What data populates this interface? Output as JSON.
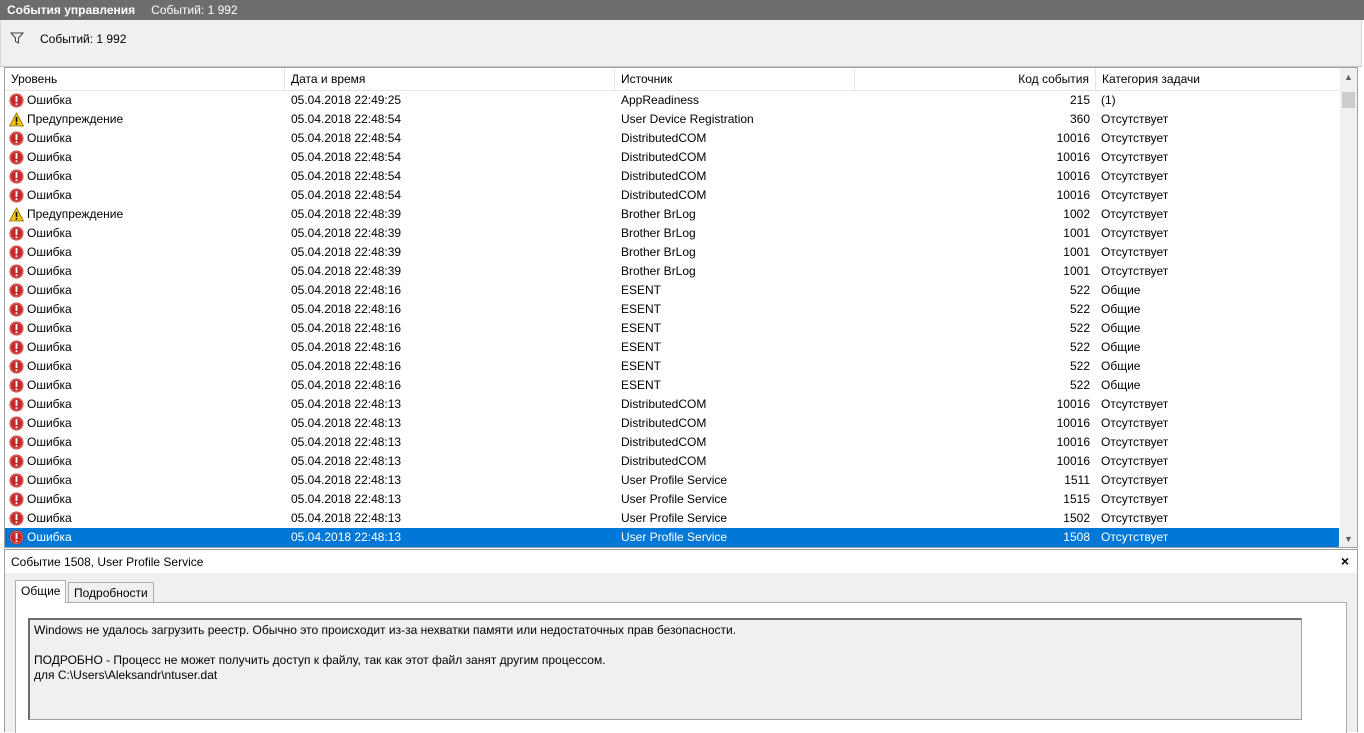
{
  "titlebar": {
    "title": "События управления",
    "count": "Событий: 1 992"
  },
  "filterbar": {
    "text": "Событий: 1 992",
    "icon": "filter-icon"
  },
  "columns": [
    "Уровень",
    "Дата и время",
    "Источник",
    "Код события",
    "Категория задачи"
  ],
  "rows": [
    {
      "level": "Ошибка",
      "type": "error",
      "date": "05.04.2018 22:49:25",
      "source": "AppReadiness",
      "code": "215",
      "category": "(1)"
    },
    {
      "level": "Предупреждение",
      "type": "warning",
      "date": "05.04.2018 22:48:54",
      "source": "User Device Registration",
      "code": "360",
      "category": "Отсутствует"
    },
    {
      "level": "Ошибка",
      "type": "error",
      "date": "05.04.2018 22:48:54",
      "source": "DistributedCOM",
      "code": "10016",
      "category": "Отсутствует"
    },
    {
      "level": "Ошибка",
      "type": "error",
      "date": "05.04.2018 22:48:54",
      "source": "DistributedCOM",
      "code": "10016",
      "category": "Отсутствует"
    },
    {
      "level": "Ошибка",
      "type": "error",
      "date": "05.04.2018 22:48:54",
      "source": "DistributedCOM",
      "code": "10016",
      "category": "Отсутствует"
    },
    {
      "level": "Ошибка",
      "type": "error",
      "date": "05.04.2018 22:48:54",
      "source": "DistributedCOM",
      "code": "10016",
      "category": "Отсутствует"
    },
    {
      "level": "Предупреждение",
      "type": "warning",
      "date": "05.04.2018 22:48:39",
      "source": "Brother BrLog",
      "code": "1002",
      "category": "Отсутствует"
    },
    {
      "level": "Ошибка",
      "type": "error",
      "date": "05.04.2018 22:48:39",
      "source": "Brother BrLog",
      "code": "1001",
      "category": "Отсутствует"
    },
    {
      "level": "Ошибка",
      "type": "error",
      "date": "05.04.2018 22:48:39",
      "source": "Brother BrLog",
      "code": "1001",
      "category": "Отсутствует"
    },
    {
      "level": "Ошибка",
      "type": "error",
      "date": "05.04.2018 22:48:39",
      "source": "Brother BrLog",
      "code": "1001",
      "category": "Отсутствует"
    },
    {
      "level": "Ошибка",
      "type": "error",
      "date": "05.04.2018 22:48:16",
      "source": "ESENT",
      "code": "522",
      "category": "Общие"
    },
    {
      "level": "Ошибка",
      "type": "error",
      "date": "05.04.2018 22:48:16",
      "source": "ESENT",
      "code": "522",
      "category": "Общие"
    },
    {
      "level": "Ошибка",
      "type": "error",
      "date": "05.04.2018 22:48:16",
      "source": "ESENT",
      "code": "522",
      "category": "Общие"
    },
    {
      "level": "Ошибка",
      "type": "error",
      "date": "05.04.2018 22:48:16",
      "source": "ESENT",
      "code": "522",
      "category": "Общие"
    },
    {
      "level": "Ошибка",
      "type": "error",
      "date": "05.04.2018 22:48:16",
      "source": "ESENT",
      "code": "522",
      "category": "Общие"
    },
    {
      "level": "Ошибка",
      "type": "error",
      "date": "05.04.2018 22:48:16",
      "source": "ESENT",
      "code": "522",
      "category": "Общие"
    },
    {
      "level": "Ошибка",
      "type": "error",
      "date": "05.04.2018 22:48:13",
      "source": "DistributedCOM",
      "code": "10016",
      "category": "Отсутствует"
    },
    {
      "level": "Ошибка",
      "type": "error",
      "date": "05.04.2018 22:48:13",
      "source": "DistributedCOM",
      "code": "10016",
      "category": "Отсутствует"
    },
    {
      "level": "Ошибка",
      "type": "error",
      "date": "05.04.2018 22:48:13",
      "source": "DistributedCOM",
      "code": "10016",
      "category": "Отсутствует"
    },
    {
      "level": "Ошибка",
      "type": "error",
      "date": "05.04.2018 22:48:13",
      "source": "DistributedCOM",
      "code": "10016",
      "category": "Отсутствует"
    },
    {
      "level": "Ошибка",
      "type": "error",
      "date": "05.04.2018 22:48:13",
      "source": "User Profile Service",
      "code": "1511",
      "category": "Отсутствует"
    },
    {
      "level": "Ошибка",
      "type": "error",
      "date": "05.04.2018 22:48:13",
      "source": "User Profile Service",
      "code": "1515",
      "category": "Отсутствует"
    },
    {
      "level": "Ошибка",
      "type": "error",
      "date": "05.04.2018 22:48:13",
      "source": "User Profile Service",
      "code": "1502",
      "category": "Отсутствует"
    },
    {
      "level": "Ошибка",
      "type": "error",
      "date": "05.04.2018 22:48:13",
      "source": "User Profile Service",
      "code": "1508",
      "category": "Отсутствует",
      "selected": true
    }
  ],
  "detail": {
    "title": "Событие 1508, User Profile Service",
    "close": "×",
    "tabs": [
      "Общие",
      "Подробности"
    ],
    "message": "Windows не удалось загрузить реестр. Обычно это происходит из-за нехватки памяти или недостаточных прав безопасности.\n\n ПОДРОБНО - Процесс не может получить доступ к файлу, так как этот файл занят другим процессом.\nдля C:\\Users\\Aleksandr\\ntuser.dat"
  },
  "colors": {
    "selected": "#0078d7",
    "error": "#c62828",
    "warning": "#f2c311",
    "titlebar": "#6d6d6d"
  }
}
